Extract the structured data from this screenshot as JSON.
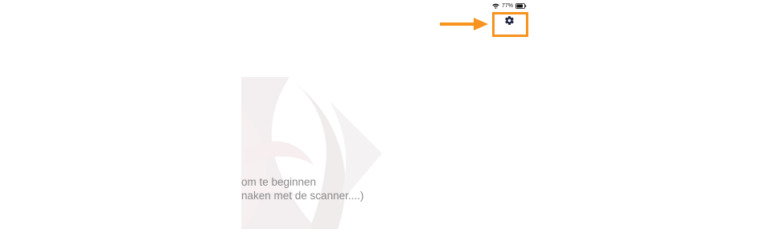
{
  "status_bar": {
    "battery_percent": "77%",
    "icons": [
      "wifi-icon",
      "battery-icon"
    ]
  },
  "settings": {
    "icon": "gear-icon",
    "highlight_color": "#f7931e"
  },
  "annotation": {
    "arrow_color": "#f7931e"
  },
  "instructions": {
    "line1": "om te beginnen",
    "line2": "naken met de scanner....)"
  },
  "colors": {
    "text_gray": "#8a8a8a",
    "gear_navy": "#1c2340",
    "logo_tint": "#efe9ea"
  }
}
